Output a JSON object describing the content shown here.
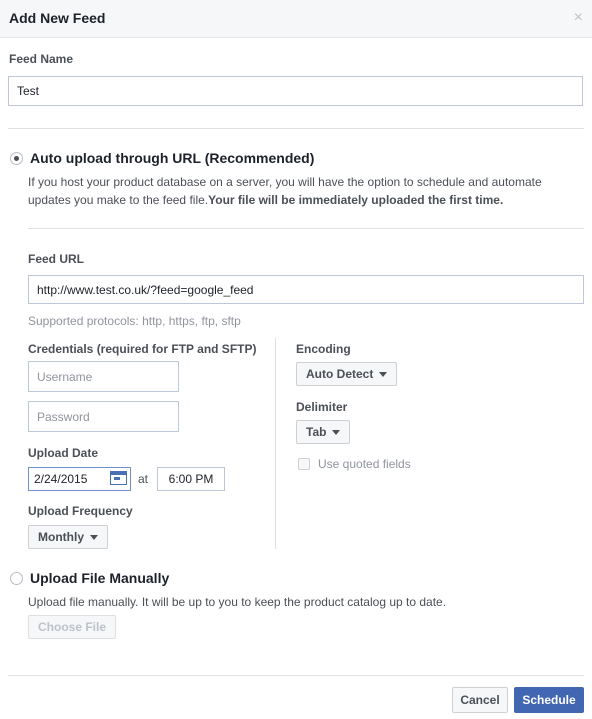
{
  "dialog": {
    "title": "Add New Feed",
    "close_glyph": "×"
  },
  "feed_name": {
    "label": "Feed Name",
    "value": "Test"
  },
  "auto_upload": {
    "title": "Auto upload through URL (Recommended)",
    "selected": true,
    "description": "If you host your product database on a server, you will have the option to schedule and automate updates you make to the feed file.",
    "description_bold": "Your file will be immediately uploaded the first time.",
    "feed_url": {
      "label": "Feed URL",
      "value": "http://www.test.co.uk/?feed=google_feed",
      "protocols_note": "Supported protocols: http, https, ftp, sftp"
    },
    "credentials": {
      "label": "Credentials (required for FTP and SFTP)",
      "username_placeholder": "Username",
      "password_placeholder": "Password"
    },
    "upload_date": {
      "label": "Upload Date",
      "date": "2/24/2015",
      "at_label": "at",
      "time": "6:00 PM"
    },
    "upload_frequency": {
      "label": "Upload Frequency",
      "selected": "Monthly"
    },
    "encoding": {
      "label": "Encoding",
      "selected": "Auto Detect"
    },
    "delimiter": {
      "label": "Delimiter",
      "selected": "Tab"
    },
    "quoted_fields": {
      "label": "Use quoted fields",
      "checked": false,
      "disabled": true
    }
  },
  "manual_upload": {
    "title": "Upload File Manually",
    "selected": false,
    "description": "Upload file manually. It will be up to you to keep the product catalog up to date.",
    "choose_file_label": "Choose File"
  },
  "footer": {
    "cancel_label": "Cancel",
    "schedule_label": "Schedule"
  },
  "colors": {
    "primary": "#4267b2",
    "border": "#bdc7d8",
    "header_bg": "#f6f7f9"
  }
}
